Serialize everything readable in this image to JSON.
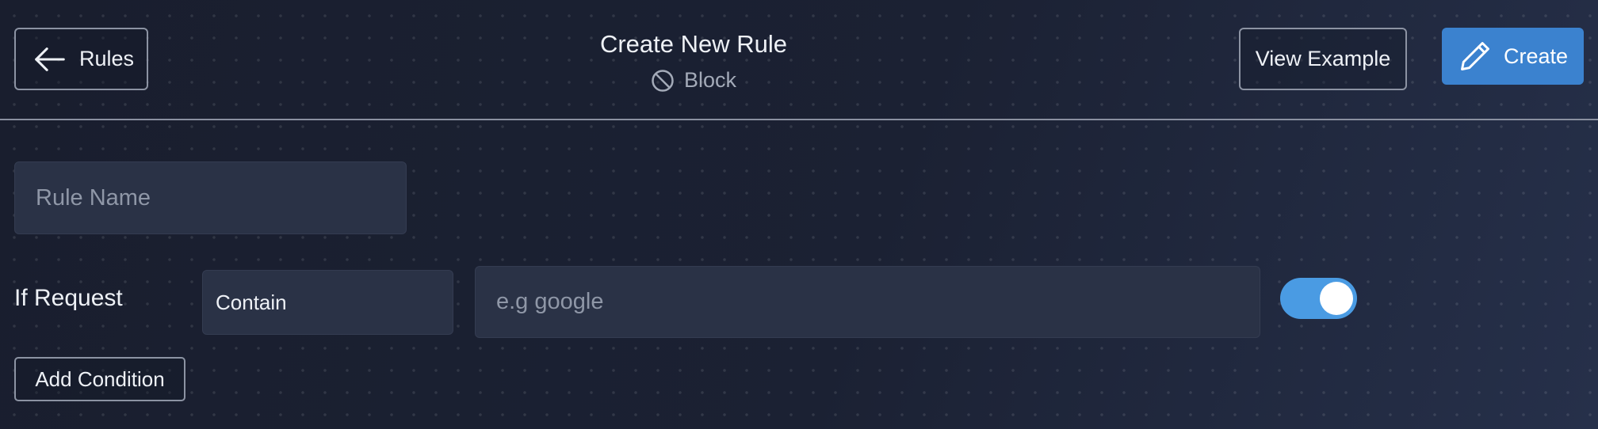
{
  "header": {
    "back_label": "Rules",
    "title": "Create New Rule",
    "subtitle": "Block",
    "example_label": "View Example",
    "create_label": "Create"
  },
  "form": {
    "rule_name": {
      "value": "",
      "placeholder": "Rule Name"
    },
    "condition_label": "If Request",
    "operator": "Contain",
    "value_field": {
      "value": "",
      "placeholder": "e.g google"
    },
    "toggle_on": true,
    "add_condition_label": "Add Condition"
  },
  "icons": {
    "back": "arrow-left-icon",
    "subtitle": "block-icon",
    "create": "pencil-icon"
  },
  "colors": {
    "background": "#1a1f30",
    "accent": "#3b82cf",
    "toggle": "#4a9be3",
    "field": "#2a3246"
  }
}
